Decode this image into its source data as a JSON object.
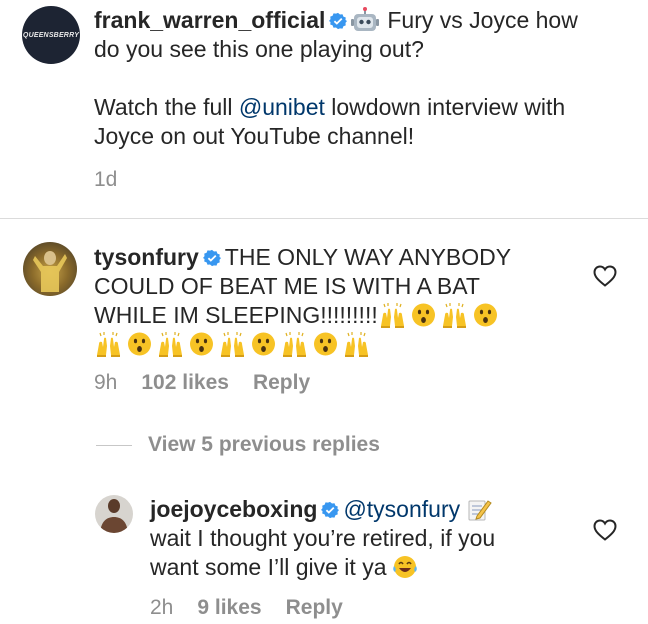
{
  "post": {
    "author": "frank_warren_official",
    "avatar_text": "QUEENSBERRY",
    "caption_emoji": "robot-emoji",
    "caption_line1": "Fury vs Joyce how",
    "caption_line2": "do you see this one playing out?",
    "caption_line3_pre": "Watch the full ",
    "caption_mention": "@unibet",
    "caption_line3_post": " lowdown interview with",
    "caption_line4": "Joyce on out YouTube channel!",
    "time": "1d"
  },
  "comments": [
    {
      "author": "tysonfury",
      "text_line1": "THE ONLY WAY ANYBODY",
      "text_line2": "COULD OF BEAT ME  IS WITH A BAT",
      "text_line3": "WHILE IM SLEEPING!!!!!!!!!",
      "emojis": [
        "raising-hands-emoji",
        "hushed-face-emoji",
        "raising-hands-emoji",
        "hushed-face-emoji",
        "raising-hands-emoji",
        "hushed-face-emoji",
        "raising-hands-emoji",
        "hushed-face-emoji",
        "raising-hands-emoji",
        "hushed-face-emoji",
        "raising-hands-emoji",
        "hushed-face-emoji",
        "raising-hands-emoji"
      ],
      "time": "9h",
      "likes": "102 likes",
      "reply": "Reply"
    }
  ],
  "view_replies": "View 5 previous replies",
  "reply": {
    "author": "joejoyceboxing",
    "mention": "@tysonfury",
    "mention_emoji": "memo-emoji",
    "text_line1": "wait I thought you’re retired, if you",
    "text_line2": "want some I’ll give it ya",
    "text_emoji": "laughing-tears-emoji",
    "time": "2h",
    "likes": "9 likes",
    "reply": "Reply"
  },
  "colors": {
    "verified": "#3897f0",
    "mention": "#00376b",
    "meta": "#8e8e8e",
    "emoji_yellow": "#f7c325"
  }
}
